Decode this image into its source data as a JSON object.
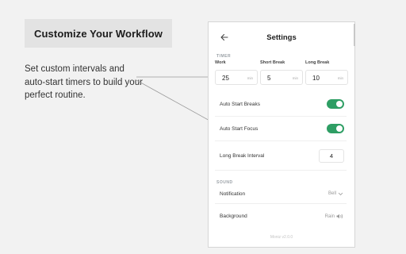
{
  "promo": {
    "title": "Customize Your Workflow",
    "description": "Set custom intervals and auto-start timers to build your perfect routine."
  },
  "settings": {
    "title": "Settings",
    "timer_section": "TIMER",
    "timers": [
      {
        "label": "Work",
        "value": "25",
        "unit": "min"
      },
      {
        "label": "Short Break",
        "value": "5",
        "unit": "min"
      },
      {
        "label": "Long Break",
        "value": "10",
        "unit": "min"
      }
    ],
    "auto_start_breaks": {
      "label": "Auto Start Breaks",
      "enabled": true
    },
    "auto_start_focus": {
      "label": "Auto Start Focus",
      "enabled": true
    },
    "long_break_interval": {
      "label": "Long Break Interval",
      "value": "4"
    },
    "sound_section": "SOUND",
    "notification": {
      "label": "Notification",
      "value": "Bell"
    },
    "background": {
      "label": "Background",
      "value": "Rain"
    },
    "version": "Moniz v2.0.0"
  },
  "colors": {
    "accent": "#2e9e64",
    "background": "#f2f2f2",
    "panel": "#ffffff"
  },
  "icons": {
    "back": "arrow-left-icon",
    "dropdown": "chevron-down-icon",
    "sound": "speaker-icon"
  }
}
